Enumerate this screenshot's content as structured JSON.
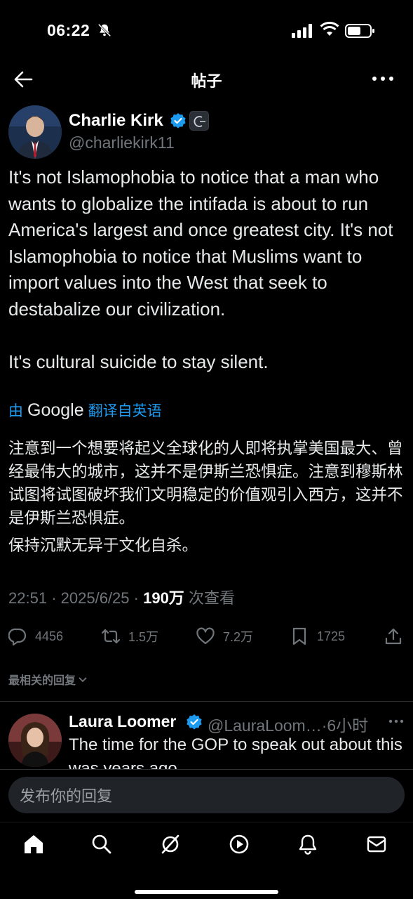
{
  "status_bar": {
    "time": "06:22"
  },
  "nav": {
    "title": "帖子"
  },
  "tweet": {
    "author_name": "Charlie Kirk",
    "author_handle": "@charliekirk11",
    "text": "It's not Islamophobia to notice that a man who wants to globalize the intifada is about to run America's largest and once greatest city. It's not Islamophobia to notice that Muslims want to import values into the West that seek to destabalize our civilization.\n\nIt's cultural suicide to stay silent.",
    "translate_prefix": "由",
    "translate_brand": "Google",
    "translate_suffix": "翻译自英语",
    "translated_p1": "注意到一个想要将起义全球化的人即将执掌美国最大、曾经最伟大的城市，这并不是伊斯兰恐惧症。注意到穆斯林试图将试图破坏我们文明稳定的价值观引入西方，这并不是伊斯兰恐惧症。",
    "translated_p2": "保持沉默无异于文化自杀。",
    "time": "22:51",
    "date": "2025/6/25",
    "views": "190万",
    "views_label": "次查看",
    "meta_sep": "·",
    "replies": "4456",
    "retweets": "1.5万",
    "likes": "7.2万",
    "bookmarks": "1725"
  },
  "replies_sort": {
    "label": "最相关的回复"
  },
  "reply": {
    "name": "Laura Loomer",
    "handle": "@LauraLoom…",
    "time": "·6小时",
    "text": "The time for the GOP to speak out about this was years ago."
  },
  "composer": {
    "placeholder": "发布你的回复"
  },
  "colors": {
    "accent": "#1d9bf0",
    "muted": "#71767b",
    "background": "#000000"
  }
}
